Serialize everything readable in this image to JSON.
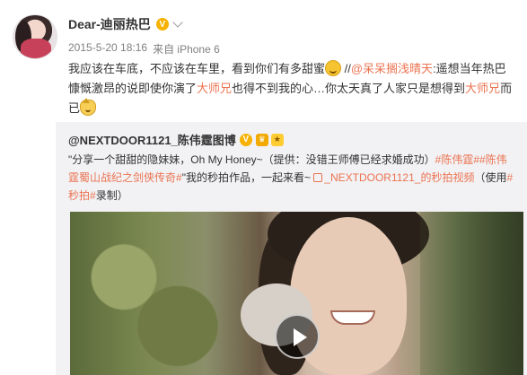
{
  "post": {
    "username": "Dear-迪丽热巴",
    "verified_badge": "V",
    "timestamp": "2015-5-20 18:16",
    "source": "来自 iPhone 6",
    "text_parts": {
      "p1": "我应该在车底，不应该在车里，看到你们有多甜蜜",
      "p2": " //",
      "mention": "@呆呆搁浅晴天",
      "p3": ":遥想当年热巴慷慨激昂的说即使你演了",
      "red1": "大师兄",
      "p4": "也得不到我的心…你太天真了人家只是想得到",
      "red2": "大师兄",
      "p5": "而已"
    },
    "emojis": [
      "smile-emoji",
      "cat-emoji"
    ]
  },
  "repost": {
    "username": "@NEXTDOOR1121_陈伟霆图博",
    "badges": [
      "V",
      "♛",
      "★"
    ],
    "text_parts": {
      "q1": "\"分享一个甜甜的隐妹妹，Oh My Honey~（提供：没错王师傅已经求婚成功）",
      "tag1": "#陈伟霆#",
      "tag2": "#陈伟霆蜀山战纪之剑侠传奇#",
      "q2": "\"我的秒拍作品，一起来看~ ",
      "link": "_NEXTDOOR1121_的秒拍视频",
      "q3": "（使用",
      "tag3": "#秒拍#",
      "q4": "录制）"
    },
    "video": {
      "play_icon": "play-icon"
    }
  },
  "colors": {
    "accent": "#eb7350",
    "verified": "#f7b100",
    "repost_bg": "#f2f2f5"
  }
}
